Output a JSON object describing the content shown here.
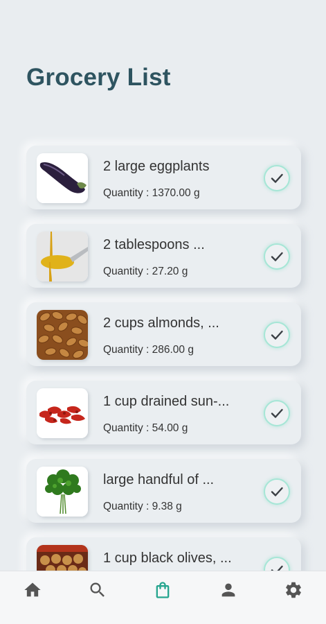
{
  "header": {
    "title": "Grocery List"
  },
  "items": [
    {
      "name": "2 large eggplants",
      "quantity": "Quantity : 1370.00 g",
      "image_icon": "eggplant-icon"
    },
    {
      "name": "2 tablespoons ...",
      "quantity": "Quantity : 27.20 g",
      "image_icon": "olive-oil-spoon-icon"
    },
    {
      "name": "2 cups almonds, ...",
      "quantity": "Quantity : 286.00 g",
      "image_icon": "almonds-icon"
    },
    {
      "name": "1 cup drained sun-...",
      "quantity": "Quantity : 54.00 g",
      "image_icon": "sun-dried-tomatoes-icon"
    },
    {
      "name": "large handful of ...",
      "quantity": "Quantity : 9.38 g",
      "image_icon": "parsley-icon"
    },
    {
      "name": "1 cup black olives, ...",
      "quantity": "",
      "image_icon": "olives-jar-icon"
    }
  ],
  "nav": [
    {
      "icon": "home-icon",
      "active": false
    },
    {
      "icon": "search-icon",
      "active": false
    },
    {
      "icon": "shopping-bag-icon",
      "active": true
    },
    {
      "icon": "person-icon",
      "active": false
    },
    {
      "icon": "gear-icon",
      "active": false
    }
  ],
  "colors": {
    "title": "#2e5460",
    "accent": "#26a58f",
    "check_ring": "#a6e6d6",
    "background": "#e9edf0",
    "nav_icon": "#555555"
  }
}
